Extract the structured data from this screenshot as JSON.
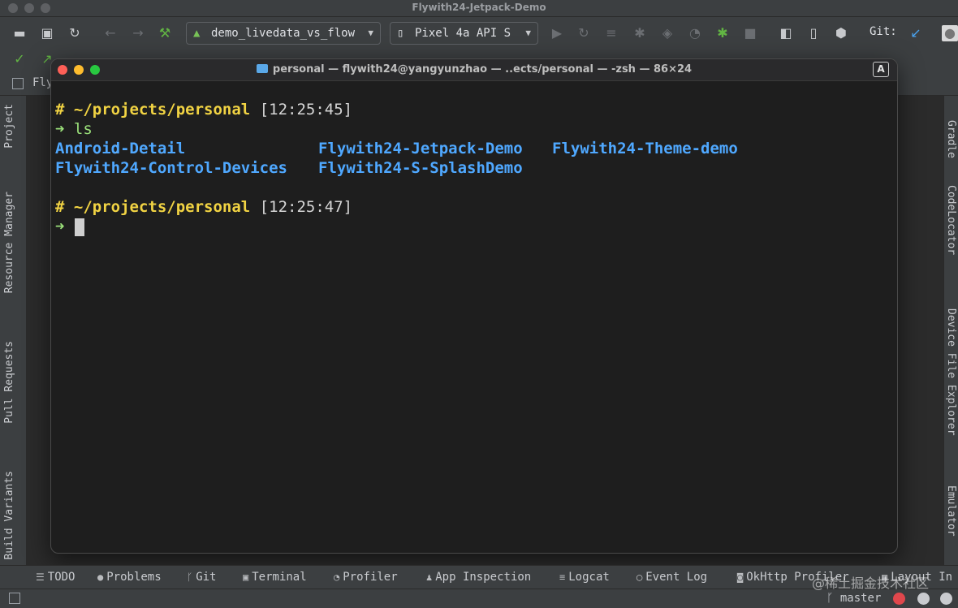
{
  "ide": {
    "window_title": "Flywith24-Jetpack-Demo",
    "run_config": "demo_livedata_vs_flow",
    "device": "Pixel 4a API S",
    "git_label": "Git:",
    "editor_tab_label": "Fly"
  },
  "left_tools": [
    "Project",
    "Resource Manager",
    "Pull Requests",
    "Build Variants"
  ],
  "right_tools": [
    "Gradle",
    "CodeLocator",
    "Device File Explorer",
    "Emulator"
  ],
  "terminal": {
    "title": "personal — flywith24@yangyunzhao — ..ects/personal — -zsh — 86×24",
    "badge": "A",
    "prompt1": {
      "hash": "#",
      "path": "~/projects/personal",
      "time": "[12:25:45]"
    },
    "cmd1": {
      "arrow": "➜",
      "command": "ls"
    },
    "ls_output": [
      [
        "Android-Detail",
        "Flywith24-Jetpack-Demo",
        "Flywith24-Theme-demo"
      ],
      [
        "Flywith24-Control-Devices",
        "Flywith24-S-SplashDemo",
        ""
      ]
    ],
    "prompt2": {
      "hash": "#",
      "path": "~/projects/personal",
      "time": "[12:25:47]"
    },
    "cmd2": {
      "arrow": "➜"
    }
  },
  "bottom_tools": [
    "TODO",
    "Problems",
    "Git",
    "Terminal",
    "Profiler",
    "App Inspection",
    "Logcat",
    "Event Log",
    "OkHttp Profiler",
    "Layout In"
  ],
  "status": {
    "branch": "master"
  },
  "watermark": "@稀土掘金技术社区"
}
